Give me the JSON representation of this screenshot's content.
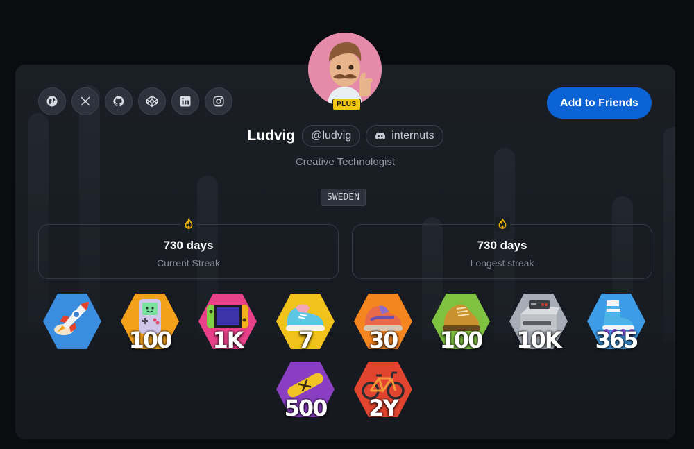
{
  "profile": {
    "name": "Ludvig",
    "handle": "@ludvig",
    "discord": "internuts",
    "title": "Creative Technologist",
    "country": "SWEDEN",
    "badge": "PLUS"
  },
  "actions": {
    "add_friends": "Add to Friends"
  },
  "social": [
    {
      "icon": "globe-icon"
    },
    {
      "icon": "x-icon"
    },
    {
      "icon": "github-icon"
    },
    {
      "icon": "codepen-icon"
    },
    {
      "icon": "linkedin-icon"
    },
    {
      "icon": "instagram-icon"
    }
  ],
  "streaks": {
    "current": {
      "value": "730 days",
      "label": "Current Streak"
    },
    "longest": {
      "value": "730 days",
      "label": "Longest streak"
    }
  },
  "badges": [
    {
      "icon": "rocket-icon",
      "text": "",
      "color": "#3b8de0"
    },
    {
      "icon": "gameboy-icon",
      "text": "100",
      "color": "#f3a11b"
    },
    {
      "icon": "switch-icon",
      "text": "1K",
      "color": "#e8418a"
    },
    {
      "icon": "sneaker-icon",
      "text": "7",
      "color": "#f1c21b"
    },
    {
      "icon": "sneaker-icon",
      "text": "30",
      "color": "#f5851f"
    },
    {
      "icon": "boot-icon",
      "text": "100",
      "color": "#7fc241"
    },
    {
      "icon": "nes-icon",
      "text": "10K",
      "color": "#a7adb6"
    },
    {
      "icon": "rollerskate-icon",
      "text": "365",
      "color": "#3e9be6"
    },
    {
      "icon": "skateboard-icon",
      "text": "500",
      "color": "#8a3ec2"
    },
    {
      "icon": "bicycle-icon",
      "text": "2Y",
      "color": "#e2452f"
    }
  ],
  "colors": {
    "accent": "#0b63d6",
    "plus": "#f3c612",
    "flame": "#f3b70f"
  }
}
